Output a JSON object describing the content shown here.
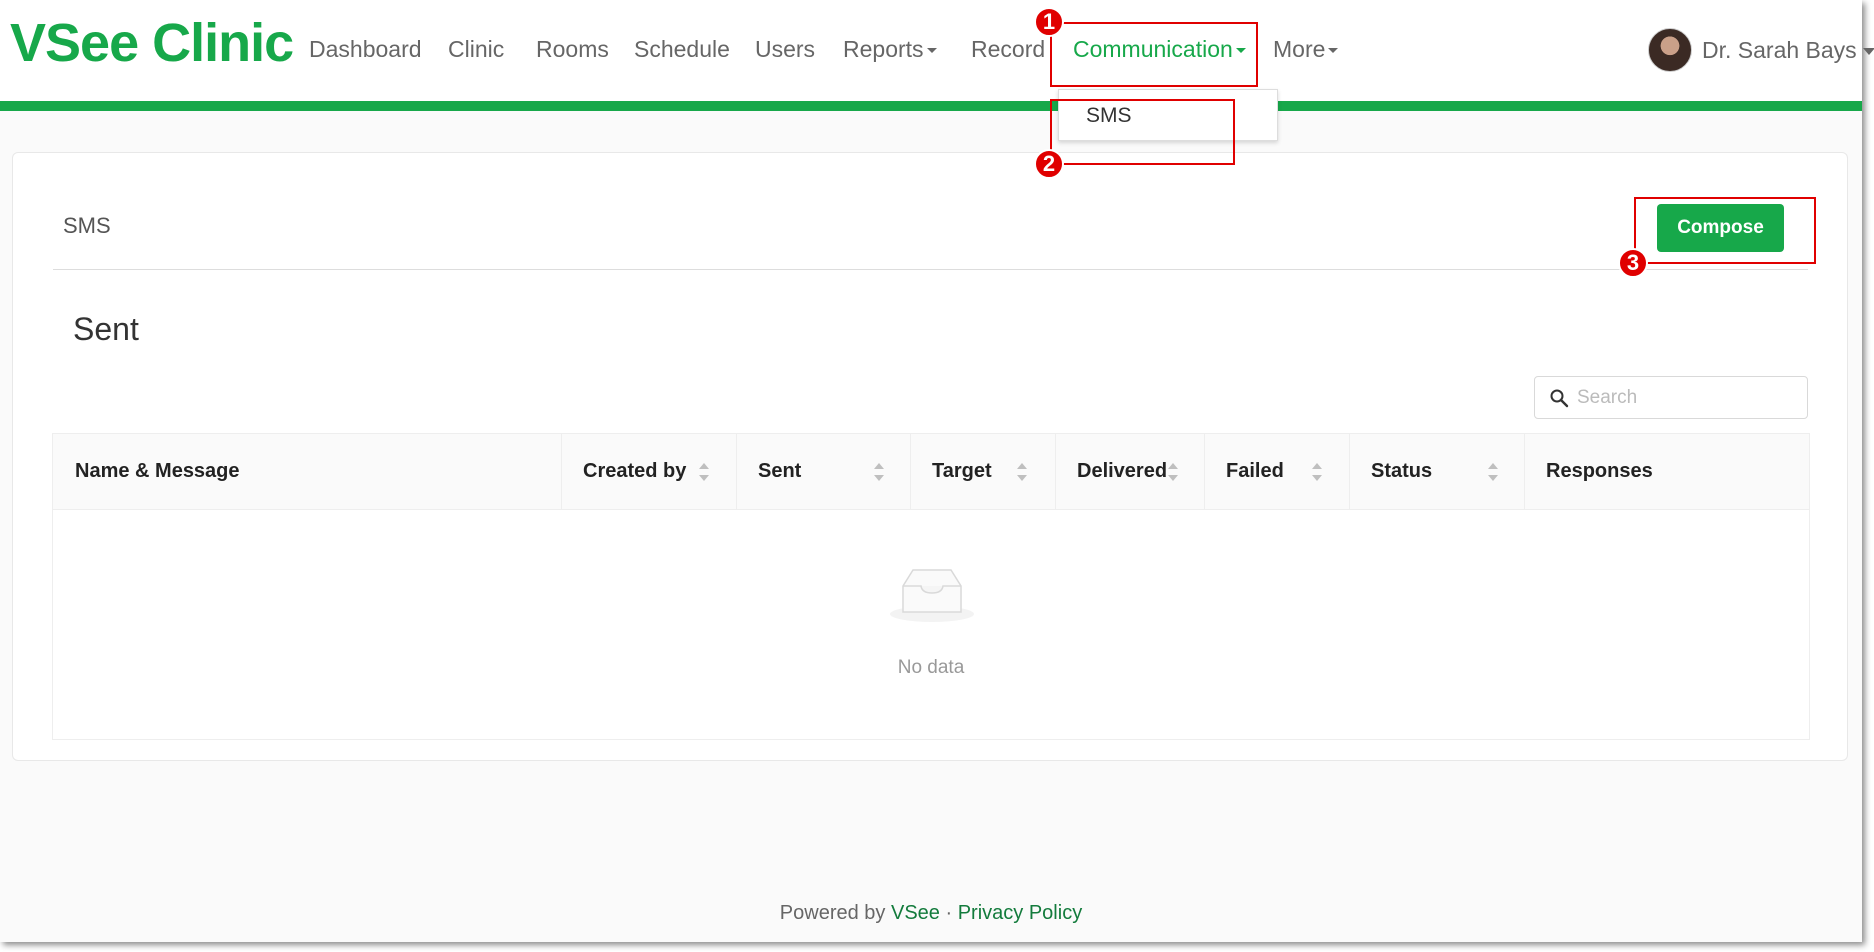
{
  "app": {
    "logo": "VSee Clinic"
  },
  "nav": {
    "items": [
      {
        "label": "Dashboard"
      },
      {
        "label": "Clinic"
      },
      {
        "label": "Rooms"
      },
      {
        "label": "Schedule"
      },
      {
        "label": "Users"
      },
      {
        "label": "Reports"
      },
      {
        "label": "Record"
      },
      {
        "label": "Communication"
      },
      {
        "label": "More"
      }
    ],
    "active": "Communication",
    "user_name": "Dr. Sarah Bays"
  },
  "dropdown": {
    "items": [
      {
        "label": "SMS"
      }
    ]
  },
  "annotations": {
    "badge1": "1",
    "badge2": "2",
    "badge3": "3",
    "color": "#e00000"
  },
  "page": {
    "card_title": "SMS",
    "compose_label": "Compose",
    "section_title": "Sent",
    "search": {
      "placeholder": "Search",
      "value": ""
    }
  },
  "table": {
    "columns": [
      {
        "label": "Name & Message"
      },
      {
        "label": "Created by"
      },
      {
        "label": "Sent"
      },
      {
        "label": "Target"
      },
      {
        "label": "Delivered"
      },
      {
        "label": "Failed"
      },
      {
        "label": "Status"
      },
      {
        "label": "Responses"
      }
    ],
    "empty_text": "No data"
  },
  "footer": {
    "powered_by": "Powered by",
    "brand": "VSee",
    "separator": "·",
    "privacy": "Privacy Policy"
  },
  "colors": {
    "brand_green": "#17a84a",
    "link_green": "#137b3c"
  }
}
